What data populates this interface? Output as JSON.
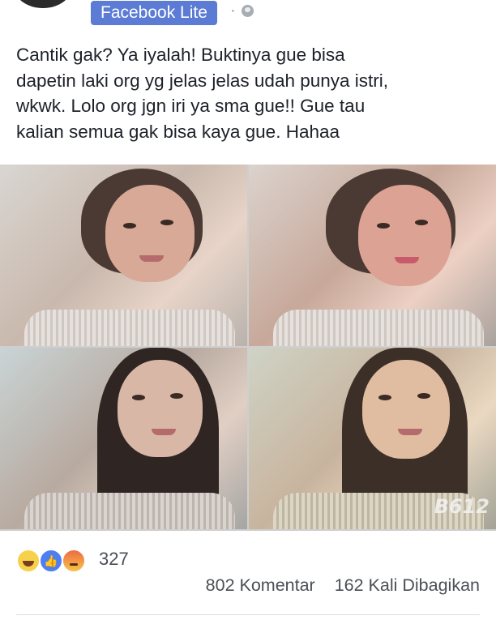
{
  "header": {
    "app_badge": "Facebook Lite",
    "separator": "·",
    "privacy_icon": "globe-icon"
  },
  "post": {
    "text_lines": [
      "Cantik gak? Ya iyalah! Buktinya gue bisa",
      "dapetin laki org yg jelas jelas udah punya istri,",
      "wkwk. Lolo org jgn iri ya sma gue!! Gue tau",
      "kalian semua gak bisa kaya gue. Hahaa"
    ],
    "watermark": "B612"
  },
  "reactions": {
    "icons": [
      "haha-icon",
      "like-icon",
      "angry-icon"
    ],
    "count": "327"
  },
  "stats": {
    "comments": "802 Komentar",
    "shares": "162 Kali Dibagikan"
  },
  "colors": {
    "badge": "#5b7bd5",
    "like": "#4e7ff1",
    "text": "#1d2129",
    "muted": "#4b4f56"
  }
}
